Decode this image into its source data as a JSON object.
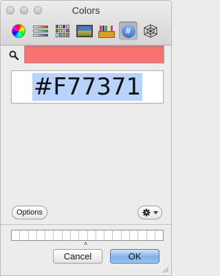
{
  "window": {
    "title": "Colors"
  },
  "toolbar": {
    "tools": [
      {
        "icon": "color-wheel-icon"
      },
      {
        "icon": "color-sliders-icon"
      },
      {
        "icon": "color-palettes-icon"
      },
      {
        "icon": "image-palettes-icon"
      },
      {
        "icon": "crayons-icon"
      },
      {
        "icon": "hex-color-icon",
        "active": true
      },
      {
        "icon": "spider-web-icon"
      }
    ]
  },
  "search": {
    "icon": "search-icon",
    "swatch_color": "#F77371"
  },
  "hex": {
    "value": "#F77371"
  },
  "options": {
    "label": "Options"
  },
  "actions": {
    "cancel_label": "Cancel",
    "ok_label": "OK"
  },
  "colors": {
    "current": "#f77371",
    "selection": "#b7d2fb",
    "ok_accent": "#7fb0ec"
  }
}
